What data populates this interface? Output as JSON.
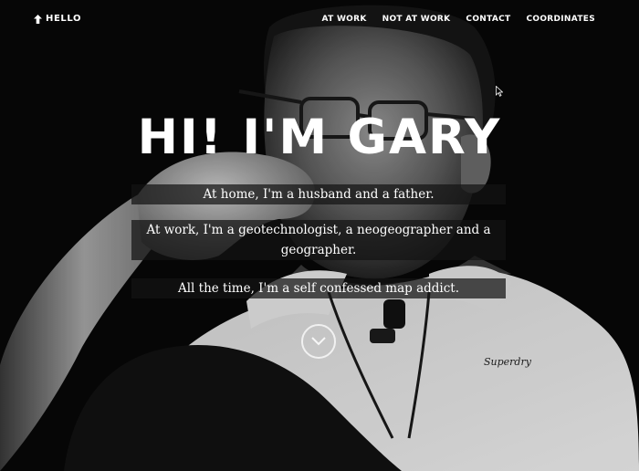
{
  "nav": {
    "home_label": "HELLO",
    "links": [
      {
        "label": "AT WORK"
      },
      {
        "label": "NOT AT WORK"
      },
      {
        "label": "CONTACT"
      },
      {
        "label": "COORDINATES"
      }
    ]
  },
  "hero": {
    "title": "HI! I'M GARY",
    "lines": [
      "At home, I'm a husband and a father.",
      "At work, I'm a geotechnologist, a neogeographer and a geographer.",
      "All the time, I'm a self confessed map addict."
    ],
    "shirt_logo_text": "Superdry"
  },
  "icons": {
    "home_arrow": "arrow-up-icon",
    "scroll": "chevron-down-icon",
    "cursor": "mouse-pointer-icon"
  },
  "colors": {
    "text": "#ffffff",
    "overlay": "#141414",
    "background": "#000000"
  }
}
